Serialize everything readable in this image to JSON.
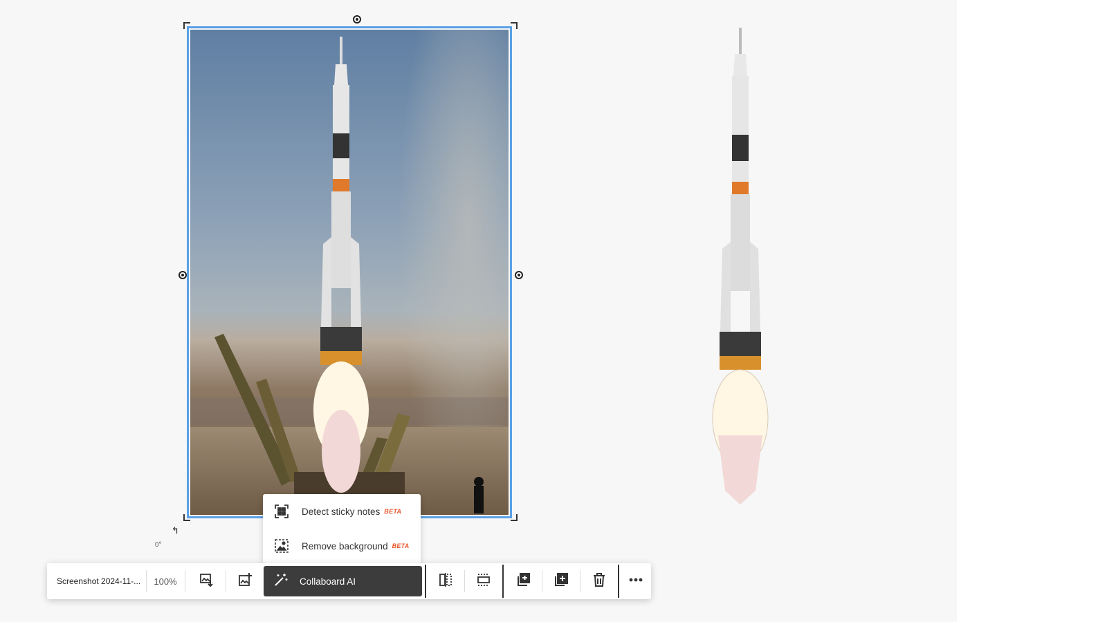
{
  "image_name": "Screenshot 2024-11-...",
  "zoom": "100%",
  "rotation_label": "0°",
  "ai_menu": {
    "items": [
      {
        "label": "Detect sticky notes",
        "badge": "BETA",
        "icon": "scan-sticky-notes-icon"
      },
      {
        "label": "Remove background",
        "badge": "BETA",
        "icon": "remove-background-icon"
      }
    ]
  },
  "toolbar": {
    "ai_label": "Collaboard AI",
    "ai_icon": "magic-wand-icon",
    "icons": [
      "replace-image-icon",
      "edit-image-icon",
      "flip-horizontal-icon",
      "crop-icon",
      "duplicate-icon",
      "add-to-icon",
      "trash-icon",
      "more-icon"
    ]
  },
  "colors": {
    "selection": "#5aa0e6",
    "beta": "#e8552a",
    "ai_button_bg": "#3c3c3c"
  }
}
